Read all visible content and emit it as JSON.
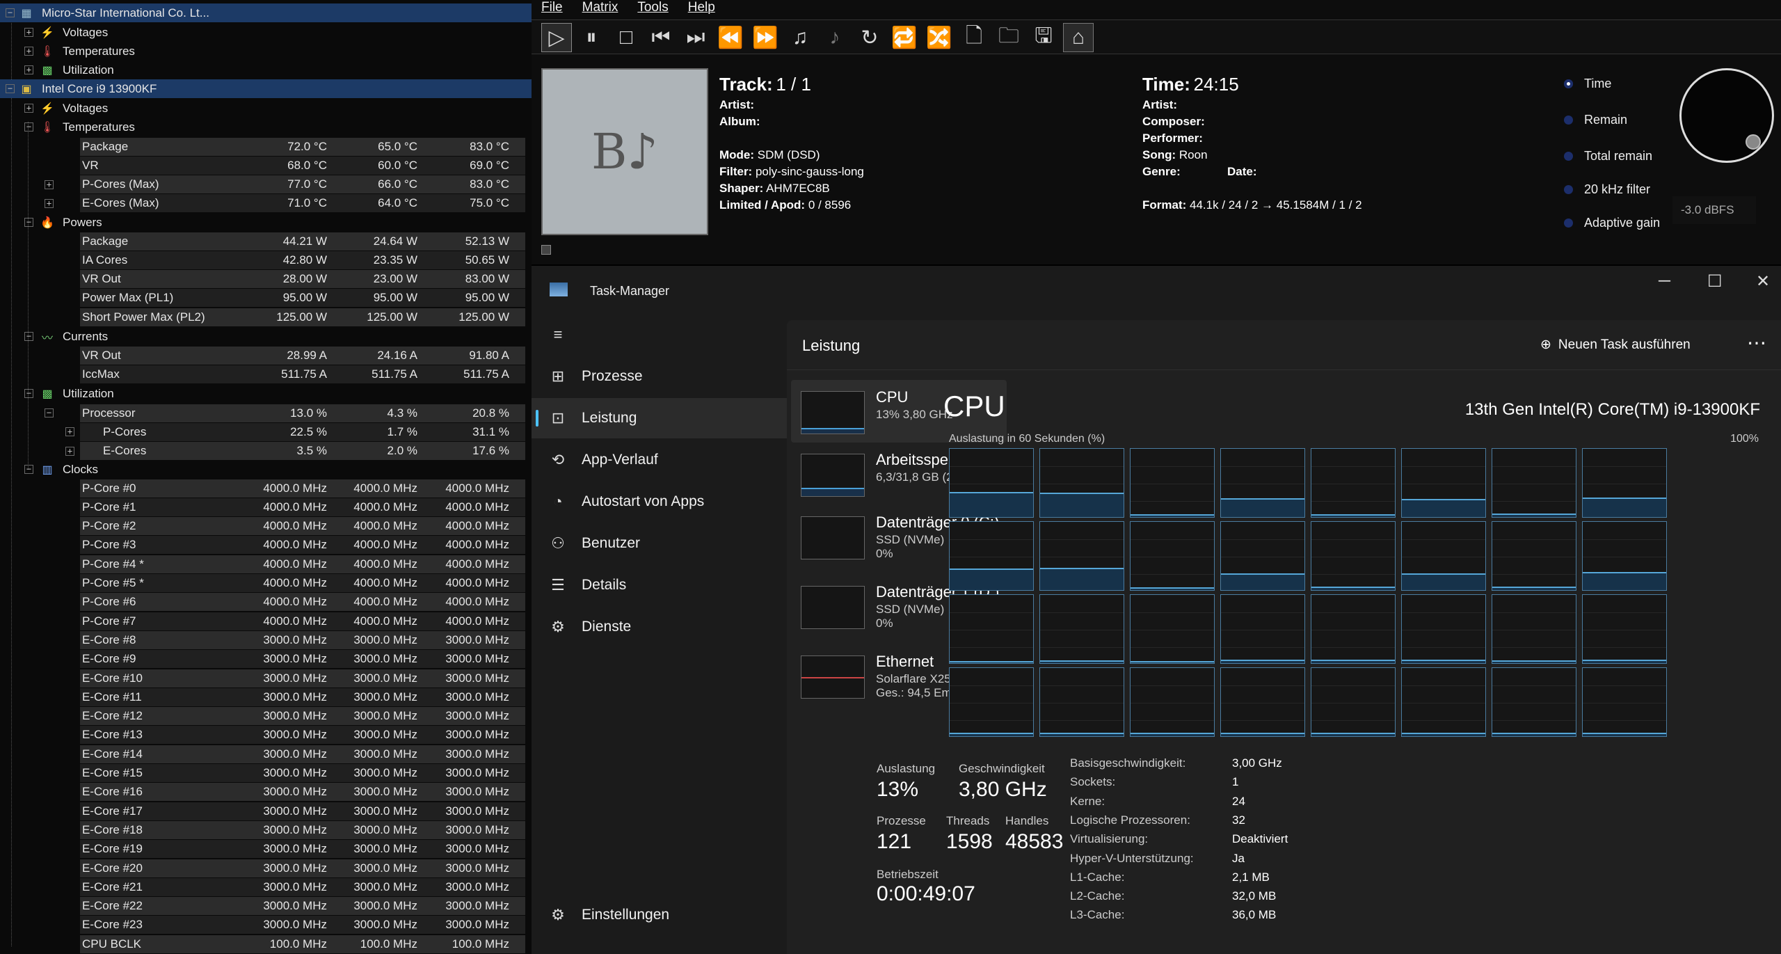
{
  "hwinfo": {
    "root1": "Micro-Star International Co. Lt...",
    "root2": "Intel Core i9 13900KF",
    "groups": {
      "voltages": "Voltages",
      "temperatures": "Temperatures",
      "utilization": "Utilization",
      "powers": "Powers",
      "currents": "Currents",
      "clocks": "Clocks"
    },
    "temps": [
      [
        "Package",
        "72.0 °C",
        "65.0 °C",
        "83.0 °C"
      ],
      [
        "VR",
        "68.0 °C",
        "60.0 °C",
        "69.0 °C"
      ],
      [
        "P-Cores (Max)",
        "77.0 °C",
        "66.0 °C",
        "83.0 °C"
      ],
      [
        "E-Cores (Max)",
        "71.0 °C",
        "64.0 °C",
        "75.0 °C"
      ]
    ],
    "powers": [
      [
        "Package",
        "44.21 W",
        "24.64 W",
        "52.13 W"
      ],
      [
        "IA Cores",
        "42.80 W",
        "23.35 W",
        "50.65 W"
      ],
      [
        "VR Out",
        "28.00 W",
        "23.00 W",
        "83.00 W"
      ],
      [
        "Power Max (PL1)",
        "95.00 W",
        "95.00 W",
        "95.00 W"
      ],
      [
        "Short Power Max (PL2)",
        "125.00 W",
        "125.00 W",
        "125.00 W"
      ]
    ],
    "currents": [
      [
        "VR Out",
        "28.99 A",
        "24.16 A",
        "91.80 A"
      ],
      [
        "IccMax",
        "511.75 A",
        "511.75 A",
        "511.75 A"
      ]
    ],
    "util": [
      [
        "Processor",
        "13.0 %",
        "4.3 %",
        "20.8 %"
      ],
      [
        "P-Cores",
        "22.5 %",
        "1.7 %",
        "31.1 %"
      ],
      [
        "E-Cores",
        "3.5 %",
        "2.0 %",
        "17.6 %"
      ]
    ],
    "clocks": [
      [
        "P-Core #0",
        "4000.0 MHz",
        "4000.0 MHz",
        "4000.0 MHz"
      ],
      [
        "P-Core #1",
        "4000.0 MHz",
        "4000.0 MHz",
        "4000.0 MHz"
      ],
      [
        "P-Core #2",
        "4000.0 MHz",
        "4000.0 MHz",
        "4000.0 MHz"
      ],
      [
        "P-Core #3",
        "4000.0 MHz",
        "4000.0 MHz",
        "4000.0 MHz"
      ],
      [
        "P-Core #4 *",
        "4000.0 MHz",
        "4000.0 MHz",
        "4000.0 MHz"
      ],
      [
        "P-Core #5 *",
        "4000.0 MHz",
        "4000.0 MHz",
        "4000.0 MHz"
      ],
      [
        "P-Core #6",
        "4000.0 MHz",
        "4000.0 MHz",
        "4000.0 MHz"
      ],
      [
        "P-Core #7",
        "4000.0 MHz",
        "4000.0 MHz",
        "4000.0 MHz"
      ],
      [
        "E-Core #8",
        "3000.0 MHz",
        "3000.0 MHz",
        "3000.0 MHz"
      ],
      [
        "E-Core #9",
        "3000.0 MHz",
        "3000.0 MHz",
        "3000.0 MHz"
      ],
      [
        "E-Core #10",
        "3000.0 MHz",
        "3000.0 MHz",
        "3000.0 MHz"
      ],
      [
        "E-Core #11",
        "3000.0 MHz",
        "3000.0 MHz",
        "3000.0 MHz"
      ],
      [
        "E-Core #12",
        "3000.0 MHz",
        "3000.0 MHz",
        "3000.0 MHz"
      ],
      [
        "E-Core #13",
        "3000.0 MHz",
        "3000.0 MHz",
        "3000.0 MHz"
      ],
      [
        "E-Core #14",
        "3000.0 MHz",
        "3000.0 MHz",
        "3000.0 MHz"
      ],
      [
        "E-Core #15",
        "3000.0 MHz",
        "3000.0 MHz",
        "3000.0 MHz"
      ],
      [
        "E-Core #16",
        "3000.0 MHz",
        "3000.0 MHz",
        "3000.0 MHz"
      ],
      [
        "E-Core #17",
        "3000.0 MHz",
        "3000.0 MHz",
        "3000.0 MHz"
      ],
      [
        "E-Core #18",
        "3000.0 MHz",
        "3000.0 MHz",
        "3000.0 MHz"
      ],
      [
        "E-Core #19",
        "3000.0 MHz",
        "3000.0 MHz",
        "3000.0 MHz"
      ],
      [
        "E-Core #20",
        "3000.0 MHz",
        "3000.0 MHz",
        "3000.0 MHz"
      ],
      [
        "E-Core #21",
        "3000.0 MHz",
        "3000.0 MHz",
        "3000.0 MHz"
      ],
      [
        "E-Core #22",
        "3000.0 MHz",
        "3000.0 MHz",
        "3000.0 MHz"
      ],
      [
        "E-Core #23",
        "3000.0 MHz",
        "3000.0 MHz",
        "3000.0 MHz"
      ],
      [
        "CPU BCLK",
        "100.0 MHz",
        "100.0 MHz",
        "100.0 MHz"
      ]
    ]
  },
  "player": {
    "menu": [
      "File",
      "Matrix",
      "Tools",
      "Help"
    ],
    "art_glyph": "B♪",
    "track_label": "Track:",
    "track_value": "1 / 1",
    "artist": "Artist:",
    "album": "Album:",
    "mode_label": "Mode:",
    "mode": "SDM (DSD)",
    "filter_label": "Filter:",
    "filter": "poly-sinc-gauss-long",
    "shaper_label": "Shaper:",
    "shaper": "AHM7EC8B",
    "limited_label": "Limited / Apod:",
    "limited": "0 / 8596",
    "time_label": "Time:",
    "time_value": "24:15",
    "artist2": "Artist:",
    "composer": "Composer:",
    "performer": "Performer:",
    "song_label": "Song:",
    "song": "Roon",
    "genre": "Genre:",
    "date": "Date:",
    "format_label": "Format:",
    "format": "44.1k / 24 / 2 → 45.1584M / 1 / 2",
    "radios": [
      "Time",
      "Remain",
      "Total remain",
      "20 kHz filter",
      "Adaptive gain"
    ],
    "gain": "-3.0 dBFS"
  },
  "taskmanager": {
    "title": "Task-Manager",
    "nav": [
      "Prozesse",
      "Leistung",
      "App-Verlauf",
      "Autostart von Apps",
      "Benutzer",
      "Details",
      "Dienste"
    ],
    "settings": "Einstellungen",
    "page_title": "Leistung",
    "new_task": "Neuen Task ausführen",
    "resources": [
      {
        "name": "CPU",
        "l1": "13% 3,80 GHz",
        "l2": ""
      },
      {
        "name": "Arbeitsspeicher",
        "l1": "6,3/31,8 GB (20%)",
        "l2": ""
      },
      {
        "name": "Datenträger 0 (C:)",
        "l1": "SSD (NVMe)",
        "l2": "0%"
      },
      {
        "name": "Datenträger 1 (D:)",
        "l1": "SSD (NVMe)",
        "l2": "0%"
      },
      {
        "name": "Ethernet",
        "l1": "Solarflare X2522 unten",
        "l2": "Ges.: 94,5 Empf.: 2,9 MB"
      }
    ],
    "cpu_title": "CPU",
    "cpu_model": "13th Gen Intel(R) Core(TM) i9-13900KF",
    "graph_label": "Auslastung in 60 Sekunden (%)",
    "graph_max": "100%",
    "core_levels": [
      0.38,
      0.36,
      0.04,
      0.28,
      0.04,
      0.27,
      0.05,
      0.29,
      0.32,
      0.33,
      0.04,
      0.25,
      0.05,
      0.25,
      0.05,
      0.27,
      0.03,
      0.04,
      0.03,
      0.05,
      0.05,
      0.05,
      0.04,
      0.05,
      0.05,
      0.05,
      0.05,
      0.05,
      0.05,
      0.05,
      0.05,
      0.05
    ],
    "stats": {
      "auslastung_label": "Auslastung",
      "auslastung": "13%",
      "speed_label": "Geschwindigkeit",
      "speed": "3,80 GHz",
      "proc_label": "Prozesse",
      "proc": "121",
      "threads_label": "Threads",
      "threads": "1598",
      "handles_label": "Handles",
      "handles": "48583",
      "uptime_label": "Betriebszeit",
      "uptime": "0:00:49:07"
    },
    "details": [
      [
        "Basisgeschwindigkeit:",
        "3,00 GHz"
      ],
      [
        "Sockets:",
        "1"
      ],
      [
        "Kerne:",
        "24"
      ],
      [
        "Logische Prozessoren:",
        "32"
      ],
      [
        "Virtualisierung:",
        "Deaktiviert"
      ],
      [
        "Hyper-V-Unterstützung:",
        "Ja"
      ],
      [
        "L1-Cache:",
        "2,1 MB"
      ],
      [
        "L2-Cache:",
        "32,0 MB"
      ],
      [
        "L3-Cache:",
        "36,0 MB"
      ]
    ]
  }
}
